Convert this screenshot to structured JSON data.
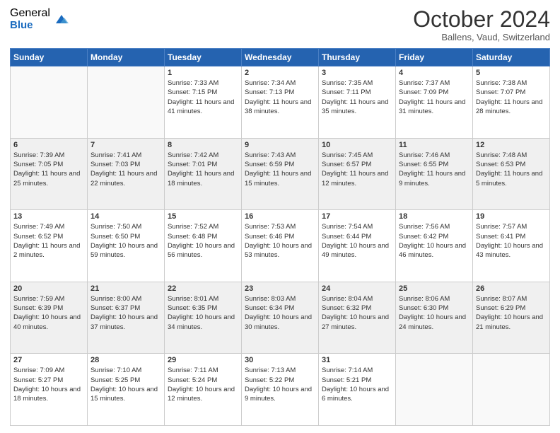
{
  "header": {
    "logo_general": "General",
    "logo_blue": "Blue",
    "month_title": "October 2024",
    "location": "Ballens, Vaud, Switzerland"
  },
  "days_of_week": [
    "Sunday",
    "Monday",
    "Tuesday",
    "Wednesday",
    "Thursday",
    "Friday",
    "Saturday"
  ],
  "weeks": [
    [
      {
        "day": "",
        "detail": ""
      },
      {
        "day": "",
        "detail": ""
      },
      {
        "day": "1",
        "detail": "Sunrise: 7:33 AM\nSunset: 7:15 PM\nDaylight: 11 hours and 41 minutes."
      },
      {
        "day": "2",
        "detail": "Sunrise: 7:34 AM\nSunset: 7:13 PM\nDaylight: 11 hours and 38 minutes."
      },
      {
        "day": "3",
        "detail": "Sunrise: 7:35 AM\nSunset: 7:11 PM\nDaylight: 11 hours and 35 minutes."
      },
      {
        "day": "4",
        "detail": "Sunrise: 7:37 AM\nSunset: 7:09 PM\nDaylight: 11 hours and 31 minutes."
      },
      {
        "day": "5",
        "detail": "Sunrise: 7:38 AM\nSunset: 7:07 PM\nDaylight: 11 hours and 28 minutes."
      }
    ],
    [
      {
        "day": "6",
        "detail": "Sunrise: 7:39 AM\nSunset: 7:05 PM\nDaylight: 11 hours and 25 minutes."
      },
      {
        "day": "7",
        "detail": "Sunrise: 7:41 AM\nSunset: 7:03 PM\nDaylight: 11 hours and 22 minutes."
      },
      {
        "day": "8",
        "detail": "Sunrise: 7:42 AM\nSunset: 7:01 PM\nDaylight: 11 hours and 18 minutes."
      },
      {
        "day": "9",
        "detail": "Sunrise: 7:43 AM\nSunset: 6:59 PM\nDaylight: 11 hours and 15 minutes."
      },
      {
        "day": "10",
        "detail": "Sunrise: 7:45 AM\nSunset: 6:57 PM\nDaylight: 11 hours and 12 minutes."
      },
      {
        "day": "11",
        "detail": "Sunrise: 7:46 AM\nSunset: 6:55 PM\nDaylight: 11 hours and 9 minutes."
      },
      {
        "day": "12",
        "detail": "Sunrise: 7:48 AM\nSunset: 6:53 PM\nDaylight: 11 hours and 5 minutes."
      }
    ],
    [
      {
        "day": "13",
        "detail": "Sunrise: 7:49 AM\nSunset: 6:52 PM\nDaylight: 11 hours and 2 minutes."
      },
      {
        "day": "14",
        "detail": "Sunrise: 7:50 AM\nSunset: 6:50 PM\nDaylight: 10 hours and 59 minutes."
      },
      {
        "day": "15",
        "detail": "Sunrise: 7:52 AM\nSunset: 6:48 PM\nDaylight: 10 hours and 56 minutes."
      },
      {
        "day": "16",
        "detail": "Sunrise: 7:53 AM\nSunset: 6:46 PM\nDaylight: 10 hours and 53 minutes."
      },
      {
        "day": "17",
        "detail": "Sunrise: 7:54 AM\nSunset: 6:44 PM\nDaylight: 10 hours and 49 minutes."
      },
      {
        "day": "18",
        "detail": "Sunrise: 7:56 AM\nSunset: 6:42 PM\nDaylight: 10 hours and 46 minutes."
      },
      {
        "day": "19",
        "detail": "Sunrise: 7:57 AM\nSunset: 6:41 PM\nDaylight: 10 hours and 43 minutes."
      }
    ],
    [
      {
        "day": "20",
        "detail": "Sunrise: 7:59 AM\nSunset: 6:39 PM\nDaylight: 10 hours and 40 minutes."
      },
      {
        "day": "21",
        "detail": "Sunrise: 8:00 AM\nSunset: 6:37 PM\nDaylight: 10 hours and 37 minutes."
      },
      {
        "day": "22",
        "detail": "Sunrise: 8:01 AM\nSunset: 6:35 PM\nDaylight: 10 hours and 34 minutes."
      },
      {
        "day": "23",
        "detail": "Sunrise: 8:03 AM\nSunset: 6:34 PM\nDaylight: 10 hours and 30 minutes."
      },
      {
        "day": "24",
        "detail": "Sunrise: 8:04 AM\nSunset: 6:32 PM\nDaylight: 10 hours and 27 minutes."
      },
      {
        "day": "25",
        "detail": "Sunrise: 8:06 AM\nSunset: 6:30 PM\nDaylight: 10 hours and 24 minutes."
      },
      {
        "day": "26",
        "detail": "Sunrise: 8:07 AM\nSunset: 6:29 PM\nDaylight: 10 hours and 21 minutes."
      }
    ],
    [
      {
        "day": "27",
        "detail": "Sunrise: 7:09 AM\nSunset: 5:27 PM\nDaylight: 10 hours and 18 minutes."
      },
      {
        "day": "28",
        "detail": "Sunrise: 7:10 AM\nSunset: 5:25 PM\nDaylight: 10 hours and 15 minutes."
      },
      {
        "day": "29",
        "detail": "Sunrise: 7:11 AM\nSunset: 5:24 PM\nDaylight: 10 hours and 12 minutes."
      },
      {
        "day": "30",
        "detail": "Sunrise: 7:13 AM\nSunset: 5:22 PM\nDaylight: 10 hours and 9 minutes."
      },
      {
        "day": "31",
        "detail": "Sunrise: 7:14 AM\nSunset: 5:21 PM\nDaylight: 10 hours and 6 minutes."
      },
      {
        "day": "",
        "detail": ""
      },
      {
        "day": "",
        "detail": ""
      }
    ]
  ]
}
